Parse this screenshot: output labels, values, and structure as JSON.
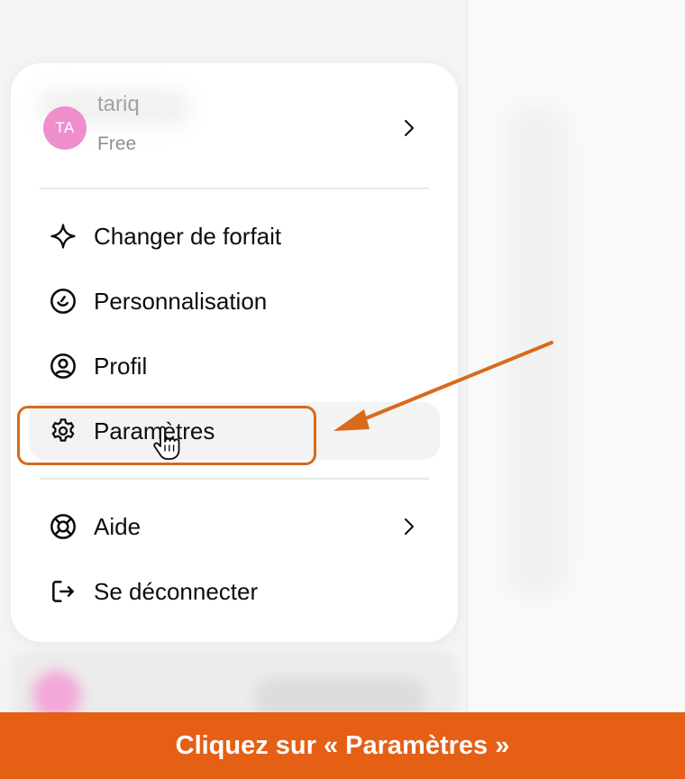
{
  "account": {
    "avatar_initials": "TA",
    "name": "tariq",
    "plan": "Free",
    "avatar_color": "#ee8fcc"
  },
  "menu_items": [
    {
      "label": "Changer de forfait",
      "icon": "sparkle-icon"
    },
    {
      "label": "Personnalisation",
      "icon": "personalization-icon"
    },
    {
      "label": "Profil",
      "icon": "user-circle-icon"
    },
    {
      "label": "Paramètres",
      "icon": "gear-icon",
      "highlighted": true
    },
    {
      "label": "Aide",
      "icon": "lifebuoy-icon",
      "has_submenu": true
    },
    {
      "label": "Se déconnecter",
      "icon": "logout-icon"
    }
  ],
  "banner": {
    "text": "Cliquez sur « Paramètres »",
    "color": "#e55f14"
  },
  "annotation": {
    "color": "#d96a1a"
  }
}
